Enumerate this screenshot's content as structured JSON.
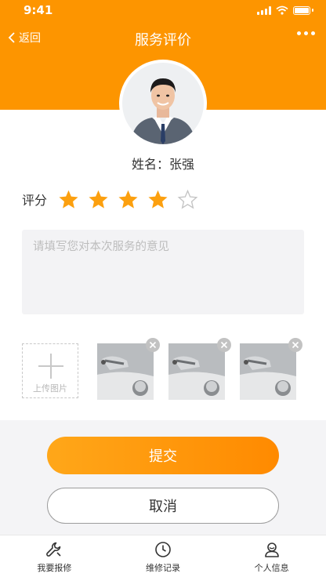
{
  "status_bar": {
    "time": "9:41"
  },
  "nav": {
    "back_label": "返回",
    "title": "服务评价"
  },
  "technician": {
    "name_line": "姓名：张强"
  },
  "rating": {
    "label": "评分",
    "value": 4,
    "max": 5
  },
  "comment": {
    "placeholder": "请填写您对本次服务的意见",
    "value": ""
  },
  "upload": {
    "label": "上传图片"
  },
  "photos": {
    "count": 3
  },
  "actions": {
    "submit_label": "提交",
    "cancel_label": "取消"
  },
  "tabbar": {
    "items": [
      {
        "label": "我要报修",
        "icon": "wrench-icon"
      },
      {
        "label": "维修记录",
        "icon": "clock-icon"
      },
      {
        "label": "个人信息",
        "icon": "person-icon"
      }
    ]
  },
  "colors": {
    "primary": "#fd9500",
    "star": "#fca00f"
  }
}
